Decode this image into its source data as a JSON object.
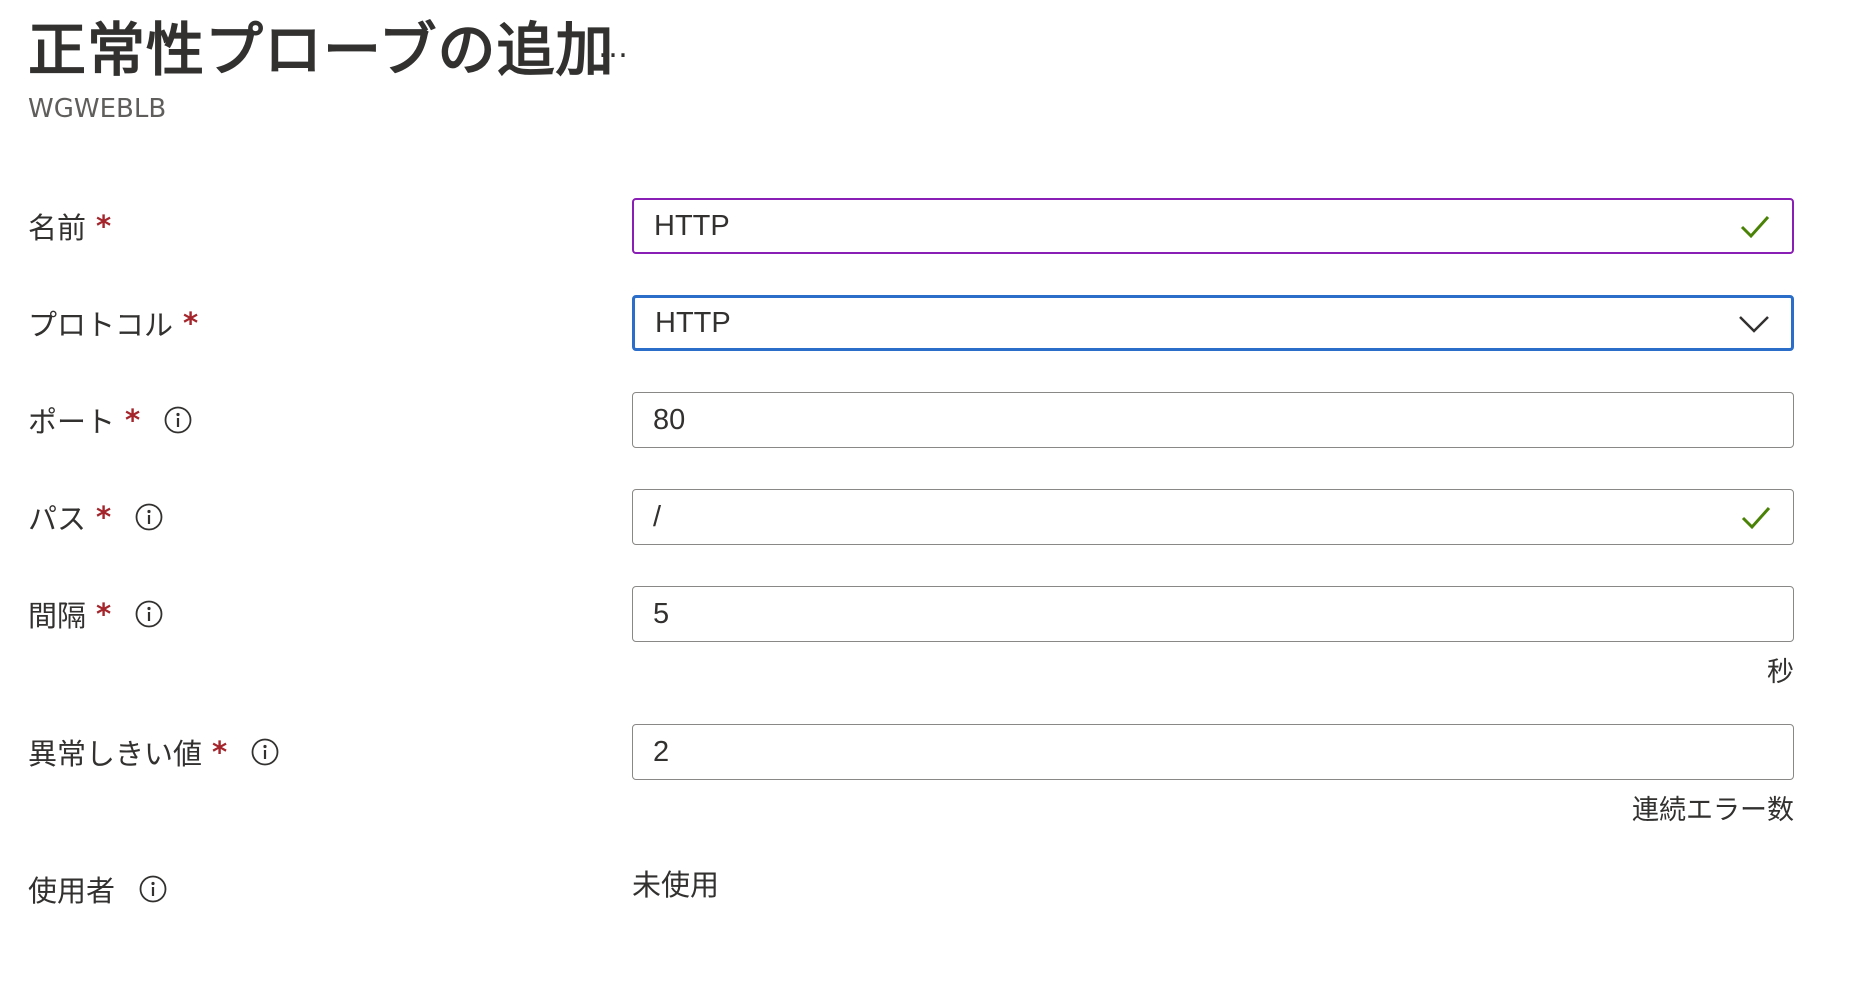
{
  "header": {
    "title": "正常性プローブの追加",
    "more_label": "…",
    "subtitle": "WGWEBLB"
  },
  "form": {
    "name": {
      "label": "名前",
      "required_mark": "*",
      "value": "HTTP",
      "validation_icon": "check-icon"
    },
    "protocol": {
      "label": "プロトコル",
      "required_mark": "*",
      "selected_value": "HTTP",
      "dropdown_icon": "chevron-down-icon"
    },
    "port": {
      "label": "ポート",
      "required_mark": "*",
      "info_icon": "info-icon",
      "value": "80"
    },
    "path": {
      "label": "パス",
      "required_mark": "*",
      "info_icon": "info-icon",
      "value": "/",
      "validation_icon": "check-icon"
    },
    "interval": {
      "label": "間隔",
      "required_mark": "*",
      "info_icon": "info-icon",
      "value": "5",
      "unit": "秒"
    },
    "unhealthy_threshold": {
      "label": "異常しきい値",
      "required_mark": "*",
      "info_icon": "info-icon",
      "value": "2",
      "unit": "連続エラー数"
    },
    "used_by": {
      "label": "使用者",
      "info_icon": "info-icon",
      "value": "未使用"
    }
  },
  "colors": {
    "required_star": "#a4262c",
    "name_input_border": "#8a1fb5",
    "protocol_input_border": "#2b6ec9",
    "default_input_border": "#8a8886",
    "valid_check": "#498205",
    "text": "#323130"
  }
}
